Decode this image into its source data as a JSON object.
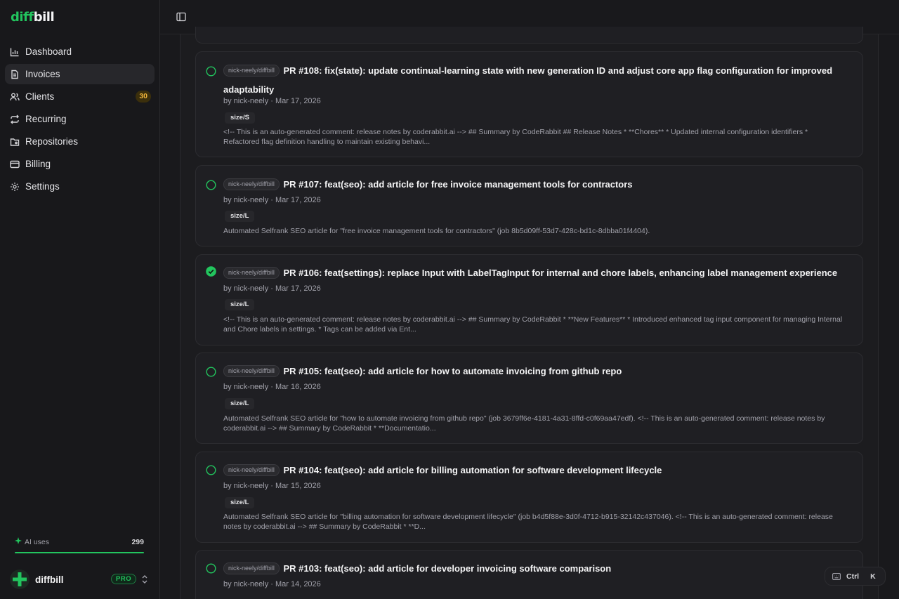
{
  "brand": {
    "part1": "diff",
    "part2": "bill"
  },
  "sidebar": {
    "items": [
      {
        "label": "Dashboard",
        "icon": "chart-icon"
      },
      {
        "label": "Invoices",
        "icon": "document-icon",
        "active": true
      },
      {
        "label": "Clients",
        "icon": "users-icon",
        "badge": "30"
      },
      {
        "label": "Recurring",
        "icon": "repeat-icon"
      },
      {
        "label": "Repositories",
        "icon": "folder-git-icon"
      },
      {
        "label": "Billing",
        "icon": "credit-card-icon"
      },
      {
        "label": "Settings",
        "icon": "gear-icon"
      }
    ],
    "ai_uses": {
      "label": "AI uses",
      "value": "299",
      "fill_fraction": 1.0
    },
    "account": {
      "name": "diffbill",
      "plan": "PRO"
    }
  },
  "pull_requests": [
    {
      "repo": "nick-neely/diffbill",
      "title": "PR #108: fix(state): update continual-learning state with new generation ID and adjust core app flag configuration for improved adaptability",
      "meta": "by nick-neely · Mar 17, 2026",
      "size": "size/S",
      "description": "<!-- This is an auto-generated comment: release notes by coderabbit.ai --> ## Summary by CodeRabbit ## Release Notes * **Chores** * Updated internal configuration identifiers * Refactored flag definition handling to maintain existing behavi...",
      "selected": false
    },
    {
      "repo": "nick-neely/diffbill",
      "title": "PR #107: feat(seo): add article for free invoice management tools for contractors",
      "meta": "by nick-neely · Mar 17, 2026",
      "size": "size/L",
      "description": "Automated Selfrank SEO article for \"free invoice management tools for contractors\" (job 8b5d09ff-53d7-428c-bd1c-8dbba01f4404).",
      "selected": false
    },
    {
      "repo": "nick-neely/diffbill",
      "title": "PR #106: feat(settings): replace Input with LabelTagInput for internal and chore labels, enhancing label management experience",
      "meta": "by nick-neely · Mar 17, 2026",
      "size": "size/L",
      "description": "<!-- This is an auto-generated comment: release notes by coderabbit.ai --> ## Summary by CodeRabbit * **New Features** * Introduced enhanced tag input component for managing Internal and Chore labels in settings. * Tags can be added via Ent...",
      "selected": true
    },
    {
      "repo": "nick-neely/diffbill",
      "title": "PR #105: feat(seo): add article for how to automate invoicing from github repo",
      "meta": "by nick-neely · Mar 16, 2026",
      "size": "size/L",
      "description": "Automated Selfrank SEO article for \"how to automate invoicing from github repo\" (job 3679ff6e-4181-4a31-8ffd-c0f69aa47edf). <!-- This is an auto-generated comment: release notes by coderabbit.ai --> ## Summary by CodeRabbit * **Documentatio...",
      "selected": false
    },
    {
      "repo": "nick-neely/diffbill",
      "title": "PR #104: feat(seo): add article for billing automation for software development lifecycle",
      "meta": "by nick-neely · Mar 15, 2026",
      "size": "size/L",
      "description": "Automated Selfrank SEO article for \"billing automation for software development lifecycle\" (job b4d5f88e-3d0f-4712-b915-32142c437046). <!-- This is an auto-generated comment: release notes by coderabbit.ai --> ## Summary by CodeRabbit * **D...",
      "selected": false
    },
    {
      "repo": "nick-neely/diffbill",
      "title": "PR #103: feat(seo): add article for developer invoicing software comparison",
      "meta": "by nick-neely · Mar 14, 2026",
      "size": "",
      "description": "",
      "selected": false
    }
  ],
  "shortcut": {
    "key1": "Ctrl",
    "key2": "K"
  },
  "colors": {
    "accent": "#22c55e",
    "badge": "#f0b43a",
    "background": "#19191c"
  }
}
